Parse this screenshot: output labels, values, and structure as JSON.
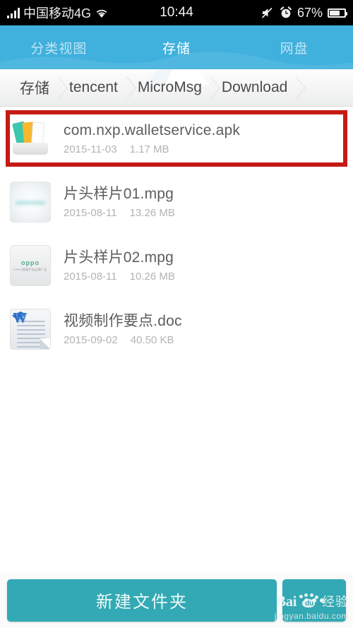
{
  "statusbar": {
    "carrier": "中国移动4G",
    "time": "10:44",
    "battery_percent": "67%",
    "icons": [
      "signal-bars-icon",
      "wifi-icon",
      "mute-icon",
      "alarm-icon",
      "battery-icon"
    ]
  },
  "header": {
    "tabs": [
      {
        "label": "分类视图",
        "active": false
      },
      {
        "label": "存储",
        "active": true
      },
      {
        "label": "网盘",
        "active": false
      }
    ]
  },
  "breadcrumb": {
    "items": [
      "存储",
      "tencent",
      "MicroMsg",
      "Download"
    ]
  },
  "files": [
    {
      "name": "com.nxp.walletservice.apk",
      "date": "2015-11-03",
      "size": "1.17 MB",
      "icon": "apk-card-icon",
      "selected": true
    },
    {
      "name": "片头样片01.mpg",
      "date": "2015-08-11",
      "size": "13.26 MB",
      "icon": "video-thumbnail-icon",
      "selected": false
    },
    {
      "name": "片头样片02.mpg",
      "date": "2015-08-11",
      "size": "10.26 MB",
      "icon": "video-thumbnail-oppo-icon",
      "selected": false,
      "thumb_text": "oppo",
      "thumb_subtext": "OPPO智能手机品牌广告"
    },
    {
      "name": "视频制作要点.doc",
      "date": "2015-09-02",
      "size": "40.50 KB",
      "icon": "word-document-icon",
      "selected": false
    }
  ],
  "bottombar": {
    "new_folder_label": "新建文件夹",
    "more_icon": "more-dots-icon"
  },
  "watermark": {
    "brand": "Bai",
    "du": "du",
    "suffix": "经验",
    "url": "jingyan.baidu.com"
  },
  "colors": {
    "header_blue": "#40b0dc",
    "teal_button": "#32a9b4",
    "selection_red": "#c61a15",
    "filename_gray": "#5d5d5d",
    "meta_gray": "#b3b3b3"
  }
}
